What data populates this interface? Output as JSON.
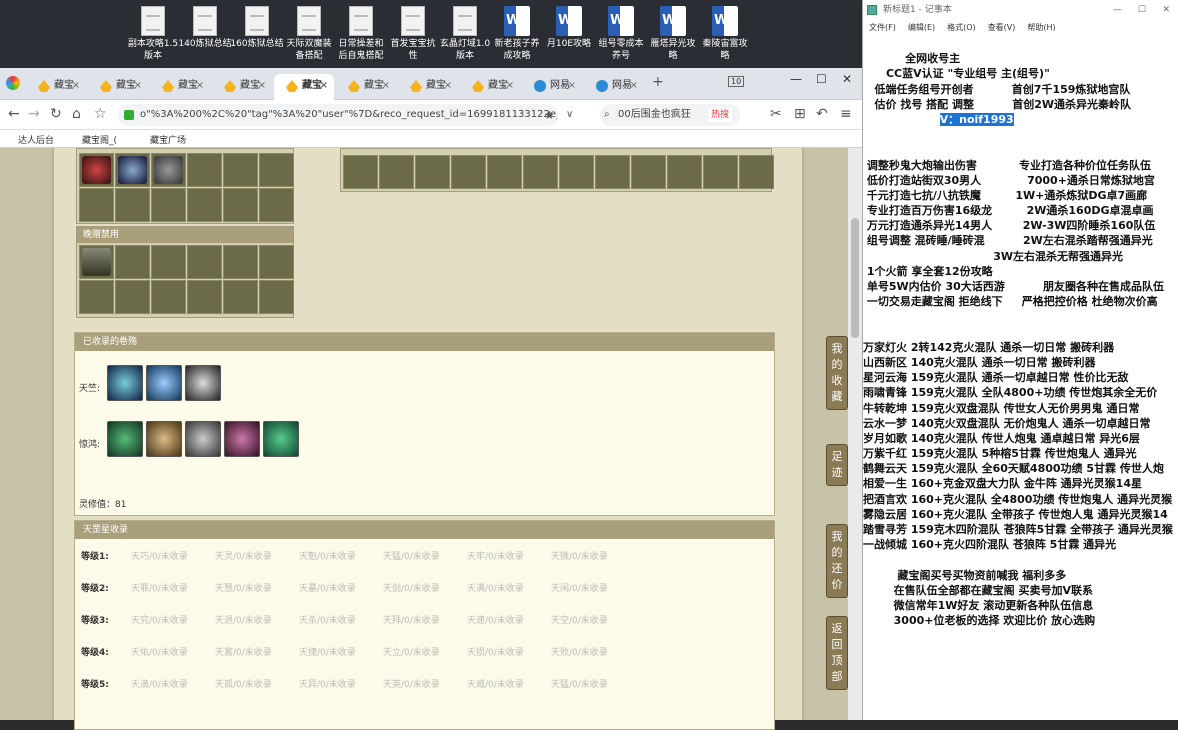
{
  "desktop": {
    "icons": [
      {
        "label": "副本攻略1.5\n版本",
        "type": "doc"
      },
      {
        "label": "140炼狱总结",
        "type": "doc"
      },
      {
        "label": "160炼狱总结",
        "type": "doc"
      },
      {
        "label": "天际双魔装\n备搭配",
        "type": "doc"
      },
      {
        "label": "日常操差和\n后自鬼搭配",
        "type": "doc"
      },
      {
        "label": "首发宝宝抗\n性",
        "type": "doc"
      },
      {
        "label": "玄晶灯域1.0\n版本",
        "type": "doc"
      },
      {
        "label": "新老孩子养\n成攻略",
        "type": "word"
      },
      {
        "label": "月10E攻略",
        "type": "word"
      },
      {
        "label": "组号零成本\n养号",
        "type": "word"
      },
      {
        "label": "雁塔异光攻\n略",
        "type": "word"
      },
      {
        "label": "秦陵宙富攻\n略",
        "type": "word"
      }
    ]
  },
  "browser": {
    "tabs": [
      {
        "label": "藏宝"
      },
      {
        "label": "藏宝"
      },
      {
        "label": "藏宝"
      },
      {
        "label": "藏宝"
      },
      {
        "label": "藏宝",
        "active": true
      },
      {
        "label": "藏宝"
      },
      {
        "label": "藏宝"
      },
      {
        "label": "藏宝"
      },
      {
        "label": "网易"
      },
      {
        "label": "网易"
      }
    ],
    "tab_count": "10",
    "url": "o\"%3A%200%2C%20\"tag\"%3A%20\"user\"%7D&reco_request_id=1699181133122e_bkR",
    "search_text": "00后围金也疯狂",
    "search_badge": "热搜",
    "bookmarks": [
      "达人后台",
      "藏宝阁_(",
      "藏宝广场"
    ]
  },
  "game": {
    "section_title_top": "晚赠禁用",
    "collected_title": "已收录的卷殇",
    "row1_label": "天竺:",
    "row2_label": "惊鸿:",
    "spirit_value": "灵修值：81",
    "collection_title": "天罡星收录",
    "levels": [
      {
        "label": "等级1:",
        "slots": [
          "天巧/0/未收录",
          "天灵/0/未收录",
          "天魁/0/未收录",
          "天猛/0/未收录",
          "天牢/0/未收录",
          "天微/0/未收录"
        ]
      },
      {
        "label": "等级2:",
        "slots": [
          "天罪/0/未收录",
          "天慧/0/未收录",
          "天暴/0/未收录",
          "天剑/0/未收录",
          "天满/0/未收录",
          "天闲/0/未收录"
        ]
      },
      {
        "label": "等级3:",
        "slots": [
          "天究/0/未收录",
          "天退/0/未收录",
          "天杀/0/未收录",
          "天拜/0/未收录",
          "天速/0/未收录",
          "天空/0/未收录"
        ]
      },
      {
        "label": "等级4:",
        "slots": [
          "天佑/0/未收录",
          "天富/0/未收录",
          "天捷/0/未收录",
          "天立/0/未收录",
          "天损/0/未收录",
          "天败/0/未收录"
        ]
      },
      {
        "label": "等级5:",
        "slots": [
          "天滴/0/未收录",
          "天孤/0/未收录",
          "天异/0/未收录",
          "天英/0/未收录",
          "天威/0/未收录",
          "天猛/0/未收录"
        ]
      }
    ],
    "side_buttons": [
      "我\n的\n收\n藏",
      "足\n迹",
      "我\n的\n还\n价",
      "返\n回\n顶\n部"
    ]
  },
  "notepad": {
    "title": "新标题1 - 记事本",
    "menu": [
      "文件(F)",
      "编辑(E)",
      "格式(O)",
      "查看(V)",
      "帮助(H)"
    ],
    "lines": [
      "",
      "           全网收号主",
      "      CC蓝V认证 \"专业组号 主(组号)\"",
      "   低端任务组号开创者          首创7千159炼狱地宫队",
      "   估价 找号 搭配 调整          首创2W通杀异光秦岭队",
      "                    V：noif1993",
      "",
      "",
      " 调整秒鬼大炮输出伤害           专业打造各种价位任务队伍",
      " 低价打造站街双30男人            7000+通杀日常炼狱地宫",
      " 千元打造七抗/八抗铁魔         1W+通杀炼狱DG卓7画廊",
      " 专业打造百万伤害16级龙         2W通杀160DG卓混卓画",
      " 万元打造通杀异光14男人        2W-3W四阶睡杀160队伍",
      " 组号调整 混砖睡/睡砖混          2W左右混杀踏帮强通异光",
      "                                  3W左右混杀无帮强通异光",
      " 1个火箭 享全套12份攻略",
      " 单号5W内估价 30大话西游          朋友圈各种在售成品队伍",
      " 一切交易走藏宝阁 拒绝线下     严格把控价格 杜绝物次价高",
      "",
      "",
      "万家灯火 2转142克火混队 通杀一切日常 搬砖利器",
      "山西新区 140克火混队 通杀一切日常 搬砖利器",
      "星河云海 159克火混队 通杀一切卓越日常 性价比无敌",
      "雨啸青锋 159克火混队 全队4800+功绩 传世炮其余全无价",
      "牛转乾坤 159克火双盘混队 传世女人无价男男鬼 通日常",
      "云水一梦 140克火双盘混队 无价炮鬼人 通杀一切卓越日常",
      "岁月如歌 140克火混队 传世人炮鬼 通卓越日常 异光6层",
      "万紫千红 159克火混队 5种榕5甘霖 传世炮鬼人 通异光",
      "鹤舞云天 159克火混队 全60天赋4800功绩 5甘霖 传世人炮",
      "相爱一生 160+克金双盘大力队 金牛阵 通异光灵猴14星",
      "把酒言欢 160+克火混队 全4800功绩 传世炮鬼人 通异光灵猴",
      "雾隐云居 160+克火混队 全带孩子 传世炮人鬼 通异光灵猴14",
      "踏雪寻芳 159克木四阶混队 苍狼阵5甘霖 全带孩子 通异光灵猴",
      "一战倾城 160+克火四阶混队 苍狼阵 5甘霖 通异光",
      "",
      "         藏宝阁买号买物资前喊我 福利多多",
      "        在售队伍全部都在藏宝阁 买卖号加V联系",
      "        微信常年1W好友 滚动更新各种队伍信息",
      "        3000+位老板的选择 欢迎比价 放心选购"
    ],
    "highlight_line": 5
  }
}
